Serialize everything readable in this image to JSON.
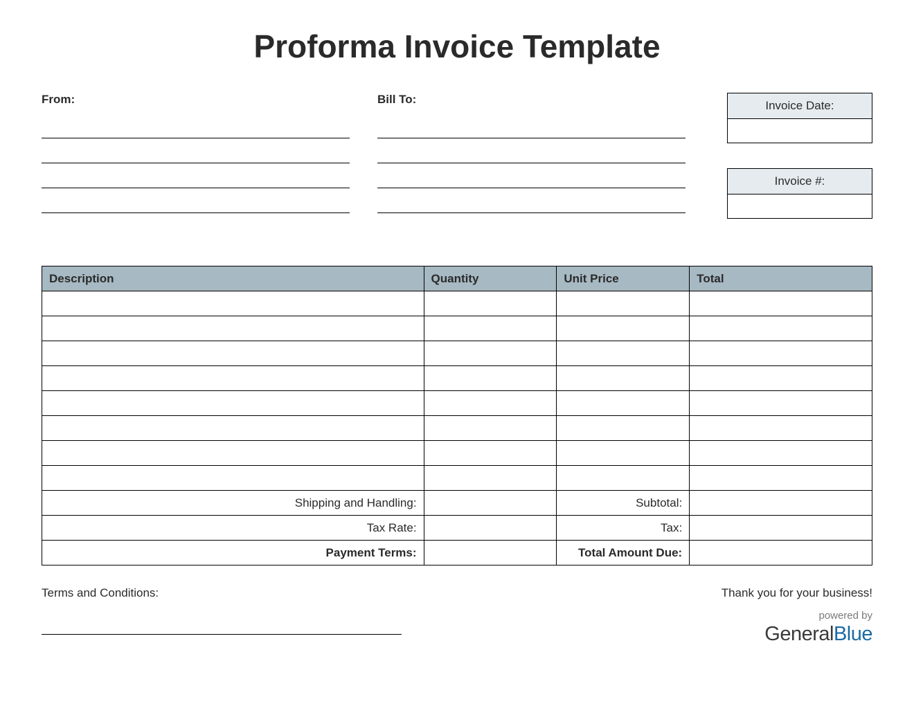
{
  "title": "Proforma Invoice Template",
  "labels": {
    "from": "From:",
    "bill_to": "Bill To:",
    "invoice_date": "Invoice Date:",
    "invoice_number": "Invoice #:"
  },
  "meta": {
    "invoice_date_value": "",
    "invoice_number_value": ""
  },
  "table": {
    "headers": {
      "description": "Description",
      "quantity": "Quantity",
      "unit_price": "Unit Price",
      "total": "Total"
    },
    "rows": [
      {
        "description": "",
        "quantity": "",
        "unit_price": "",
        "total": ""
      },
      {
        "description": "",
        "quantity": "",
        "unit_price": "",
        "total": ""
      },
      {
        "description": "",
        "quantity": "",
        "unit_price": "",
        "total": ""
      },
      {
        "description": "",
        "quantity": "",
        "unit_price": "",
        "total": ""
      },
      {
        "description": "",
        "quantity": "",
        "unit_price": "",
        "total": ""
      },
      {
        "description": "",
        "quantity": "",
        "unit_price": "",
        "total": ""
      },
      {
        "description": "",
        "quantity": "",
        "unit_price": "",
        "total": ""
      },
      {
        "description": "",
        "quantity": "",
        "unit_price": "",
        "total": ""
      }
    ],
    "summary": {
      "shipping_label": "Shipping and Handling:",
      "shipping_value": "",
      "subtotal_label": "Subtotal:",
      "subtotal_value": "",
      "tax_rate_label": "Tax Rate:",
      "tax_rate_value": "",
      "tax_label": "Tax:",
      "tax_value": "",
      "payment_terms_label": "Payment Terms:",
      "payment_terms_value": "",
      "total_due_label": "Total Amount Due:",
      "total_due_value": ""
    }
  },
  "footer": {
    "terms_label": "Terms and Conditions:",
    "thanks": "Thank you for your business!",
    "powered": "powered by",
    "brand1": "General",
    "brand2": "Blue"
  }
}
